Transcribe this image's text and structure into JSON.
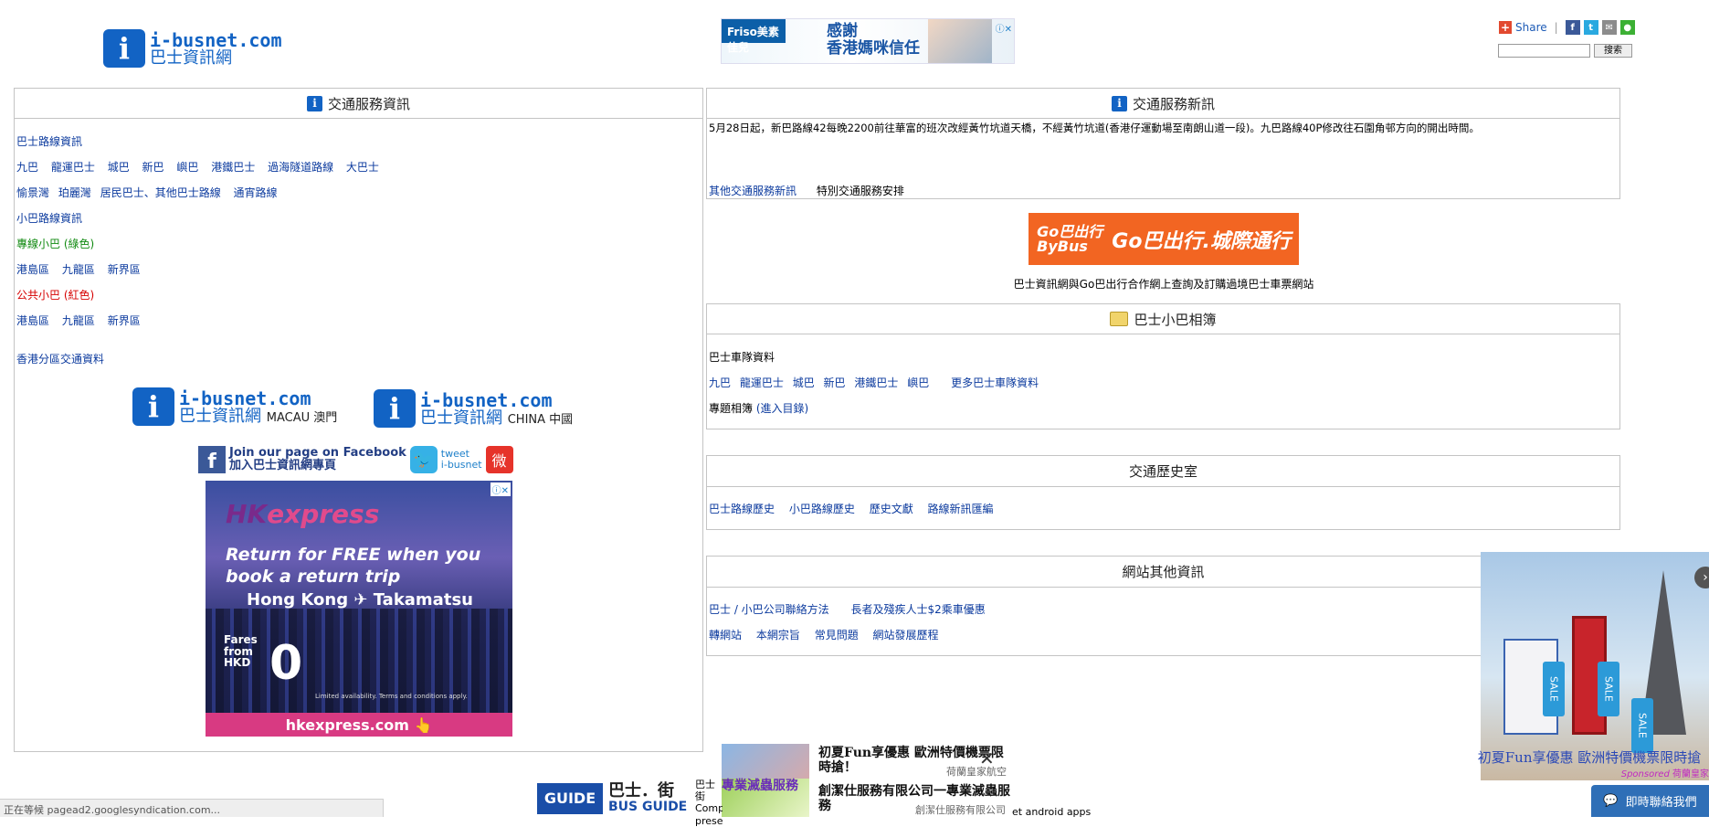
{
  "header": {
    "logo_domain": "i-busnet.com",
    "logo_zh": "巴士資訊網",
    "logo_i": "i",
    "top_ad": {
      "brand": "Friso美素佳兒",
      "line1": "感謝",
      "line2": "香港媽咪信任"
    },
    "share_label": "Share",
    "search_placeholder": "",
    "search_button": "搜索",
    "social_icons": [
      "facebook-icon",
      "twitter-icon",
      "email-icon",
      "wechat-icon"
    ]
  },
  "left_panel": {
    "title": "交通服務資訊",
    "bus_title": "巴士路線資訊",
    "bus_links": [
      "九巴",
      "龍運巴士",
      "城巴",
      "新巴",
      "嶼巴",
      "港鐵巴士",
      "過海隧道路線",
      "大巴士"
    ],
    "other_links": [
      "愉景灣",
      "珀麗灣",
      "居民巴士、其他巴士路線",
      "通宵路線"
    ],
    "minibus_title": "小巴路線資訊",
    "green_label": "專線小巴 (綠色)",
    "green_links": [
      "港島區",
      "九龍區",
      "新界區"
    ],
    "red_label": "公共小巴 (紅色)",
    "red_links": [
      "港島區",
      "九龍區",
      "新界區"
    ],
    "district_link": "香港分區交通資料"
  },
  "sister_sites": {
    "macau_domain": "i-busnet.com",
    "macau_zh": "巴士資訊網",
    "macau_tag": "MACAU 澳門",
    "china_domain": "i-busnet.com",
    "china_zh": "巴士資訊網",
    "china_tag": "CHINA 中國",
    "fb_line1": "Join our page on Facebook",
    "fb_line2": "加入巴士資訊網專頁",
    "tw_line1": "tweet",
    "tw_line2": "i-busnet"
  },
  "hk_ad": {
    "brand_a": "HK",
    "brand_b": "express",
    "headline1": "Return for FREE when you",
    "headline2": "book a return trip",
    "route": "Hong Kong ✈ Takamatsu",
    "fares1": "Fares",
    "fares2": "from",
    "fares3": "HKD",
    "price": "0",
    "fine": "Limited availability. Terms and conditions apply.",
    "url": "hkexpress.com"
  },
  "news_panel": {
    "title": "交通服務新訊",
    "body": "5月28日起，新巴路線42每晚2200前往華富的班次改經黃竹坑道天橋，不經黃竹坑道(香港仔運動場至南朗山道一段)。九巴路線40P修改往石圍角邨方向的開出時間。",
    "more_link": "其他交通服務新訊",
    "special": "特別交通服務安排"
  },
  "go_bus": {
    "logo_line1": "Go巴出行",
    "logo_line2": "ByBus",
    "title": "Go巴出行.城際通行",
    "caption": "巴士資訊網與Go巴出行合作網上查詢及訂購過境巴士車票網站"
  },
  "album_panel": {
    "title": "巴士小巴相簿",
    "fleet_title": "巴士車隊資料",
    "fleet_links": [
      "九巴",
      "龍運巴士",
      "城巴",
      "新巴",
      "港鐵巴士",
      "嶼巴"
    ],
    "more_fleet": "更多巴士車隊資料",
    "album_label": "專題相簿",
    "album_link": "(進入目錄)"
  },
  "history_panel": {
    "title": "交通歷史室",
    "links": [
      "巴士路線歷史",
      "小巴路線歷史",
      "歷史文獻",
      "路線新訊匯編"
    ]
  },
  "other_panel": {
    "title": "網站其他資訊",
    "row1": [
      "巴士 / 小巴公司聯絡方法",
      "長者及殘疾人士$2乘車優惠"
    ],
    "row2": [
      "轉網站",
      "本網宗旨",
      "常見問題",
      "網站發展歷程"
    ]
  },
  "paris_ad": {
    "caption": "初夏Fun享優惠 歐洲特價機票限時搶",
    "sponsored": "Sponsored",
    "sponsor_name": "荷蘭皇家",
    "tags": [
      "SALE",
      "SALE",
      "SALE"
    ]
  },
  "pop_ad": {
    "title1": "初夏Fun享優惠 歐洲特價機票限時搶！",
    "source1": "荷蘭皇家航空",
    "label": "專業滅蟲服務",
    "title2": "創潔仕服務有限公司一專業滅蟲服務",
    "source2": "創潔仕服務有限公司"
  },
  "bottom": {
    "guide_box": "GUIDE",
    "guide_zh": "巴士．街",
    "guide_en": "BUS GUIDE",
    "trunc_text": "巴士街 Comp prese",
    "apps_text": "et android apps",
    "status": "正在等候 pagead2.googlesyndication.com...",
    "chat": "即時聯絡我們"
  }
}
